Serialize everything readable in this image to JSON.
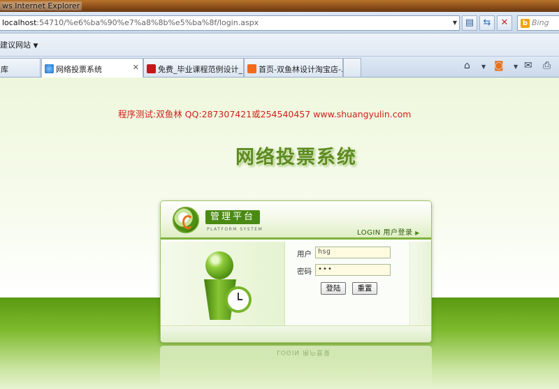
{
  "window": {
    "title": "ws Internet Explorer"
  },
  "address_bar": {
    "host": "localhost",
    "path": ":54710/%e6%ba%90%e7%a8%8b%e5%ba%8f/login.aspx",
    "search_placeholder": "Bing"
  },
  "favorites_bar": {
    "item": "建议网站"
  },
  "tabs": [
    {
      "label": "库",
      "icon": "ie-page-icon"
    },
    {
      "label": "网络投票系统",
      "icon": "ie-page-icon",
      "active": true
    },
    {
      "label": "免费_毕业课程范例设计_...",
      "icon": "red-site-icon"
    },
    {
      "label": "首页-双鱼林设计淘宝店-...",
      "icon": "taobao-icon"
    }
  ],
  "page": {
    "notice": "程序测试:双鱼林 QQ:287307421或254540457 www.shuangyulin.com",
    "title": "网络投票系统",
    "login_panel": {
      "platform_title": "管理平台",
      "platform_subtitle": "PLATFORM SYSTEM",
      "login_label": "LOGIN 用户登录",
      "username_label": "用户",
      "username_value": "hsg",
      "password_label": "密码",
      "password_value": "•••",
      "login_button": "登陆",
      "reset_button": "重置"
    },
    "reflection_text": "LOGIN 用户登录"
  },
  "colors": {
    "accent_green": "#5d8a22",
    "notice_red": "#d0201a"
  }
}
